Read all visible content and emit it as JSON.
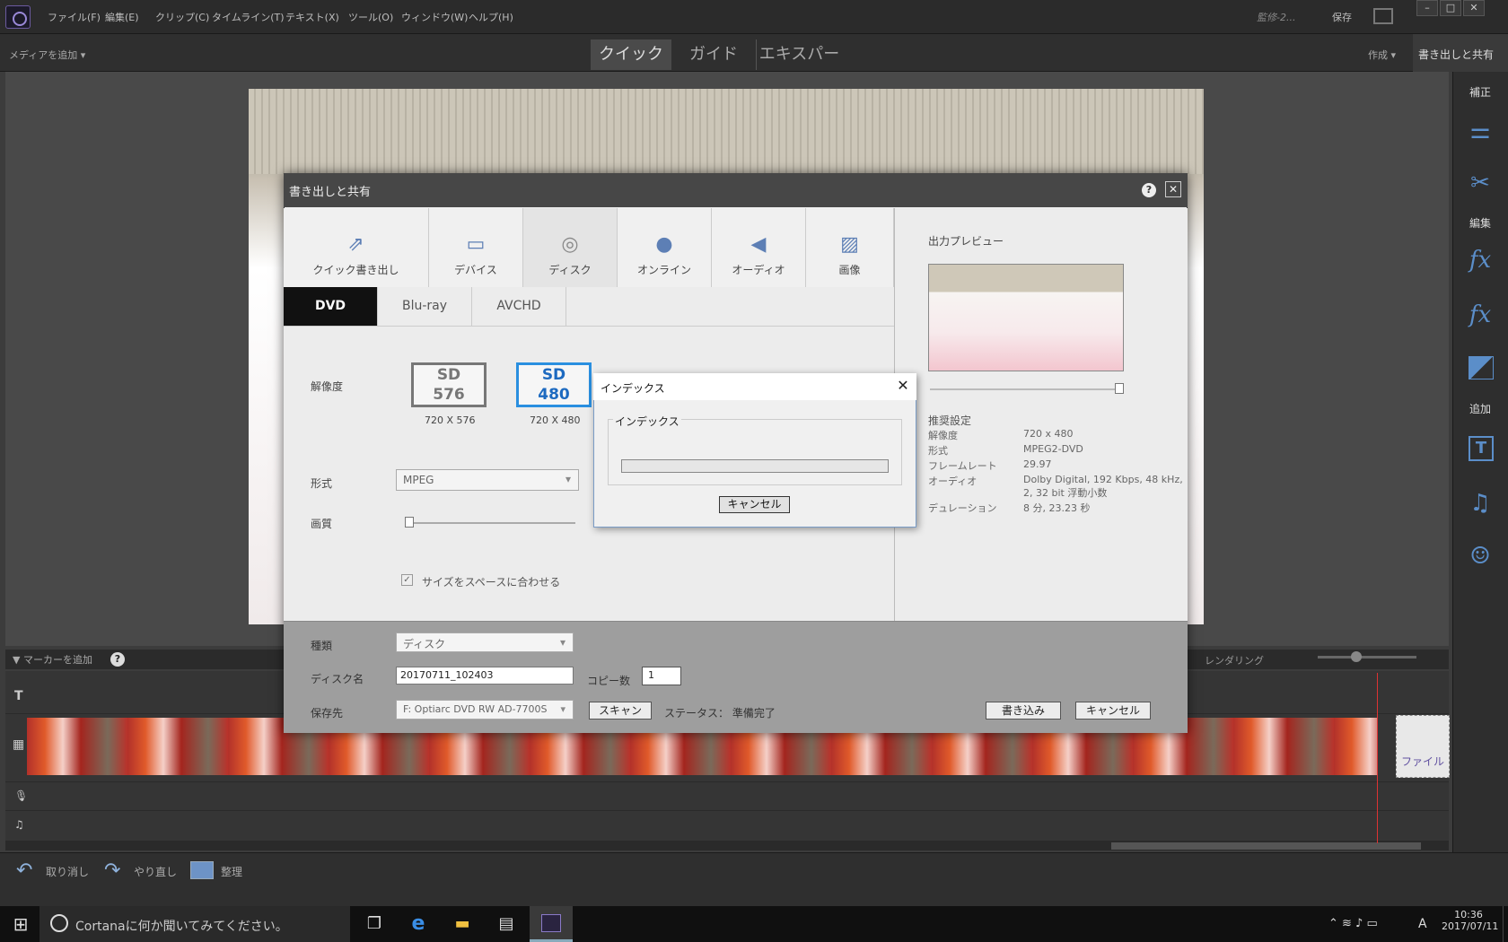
{
  "menubar": {
    "items": [
      "ファイル(F)",
      "編集(E)",
      "クリップ(C)",
      "タイムライン(T)",
      "テキスト(X)",
      "ツール(O)",
      "ウィンドウ(W)",
      "ヘルプ(H)"
    ],
    "project": "監修-2...",
    "save": "保存"
  },
  "modebar": {
    "add_media": "メディアを追加 ▾",
    "tabs": [
      "クイック",
      "ガイド",
      "エキスパート"
    ],
    "create": "作成 ▾",
    "export_share": "書き出しと共有"
  },
  "right_panel": {
    "adjust": "補正",
    "edit": "編集",
    "add": "追加",
    "fx": "fx"
  },
  "timeline": {
    "add_marker": "マーカーを追加",
    "help": "?",
    "rendering": "レンダリング",
    "file_placeholder": "ファイル"
  },
  "bottombar": {
    "undo": "取り消し",
    "redo": "やり直し",
    "organize": "整理"
  },
  "dialog": {
    "title": "書き出しと共有",
    "tabs": [
      "クイック書き出し",
      "デバイス",
      "ディスク",
      "オンライン",
      "オーディオ",
      "画像"
    ],
    "subtabs": [
      "DVD",
      "Blu-ray",
      "AVCHD"
    ],
    "resolution_label": "解像度",
    "sd576": {
      "top": "SD",
      "bottom": "576",
      "caption": "720 X 576"
    },
    "sd480": {
      "top": "SD",
      "bottom": "480",
      "caption": "720 X 480"
    },
    "format_label": "形式",
    "format_value": "MPEG",
    "quality_label": "画質",
    "fit_size": "サイズをスペースに合わせる",
    "type_label": "種類",
    "type_value": "ディスク",
    "disc_name_label": "ディスク名",
    "disc_name_value": "20170711_102403",
    "copies_label": "コピー数",
    "copies_value": "1",
    "save_to_label": "保存先",
    "save_to_value": "F: Optiarc DVD RW AD-7700S",
    "scan": "スキャン",
    "status": "ステータス： 準備完了",
    "write": "書き込み",
    "cancel": "キャンセル",
    "preview_title": "出力プレビュー",
    "recommended": "推奨設定",
    "props": [
      {
        "k": "解像度",
        "v": "720 x 480"
      },
      {
        "k": "形式",
        "v": "MPEG2-DVD"
      },
      {
        "k": "フレームレート",
        "v": "29.97"
      },
      {
        "k": "オーディオ",
        "v": "Dolby Digital, 192 Kbps, 48 kHz,"
      },
      {
        "k": "",
        "v": "2, 32 bit 浮動小数"
      },
      {
        "k": "デュレーション",
        "v": "8 分, 23.23 秒"
      }
    ]
  },
  "index_popup": {
    "title": "インデックス",
    "group": "インデックス",
    "progress": 0,
    "cancel": "キャンセル"
  },
  "taskbar": {
    "search": "Cortanaに何か聞いてみてください。",
    "time": "10:36",
    "date": "2017/07/11",
    "ime": "A"
  }
}
